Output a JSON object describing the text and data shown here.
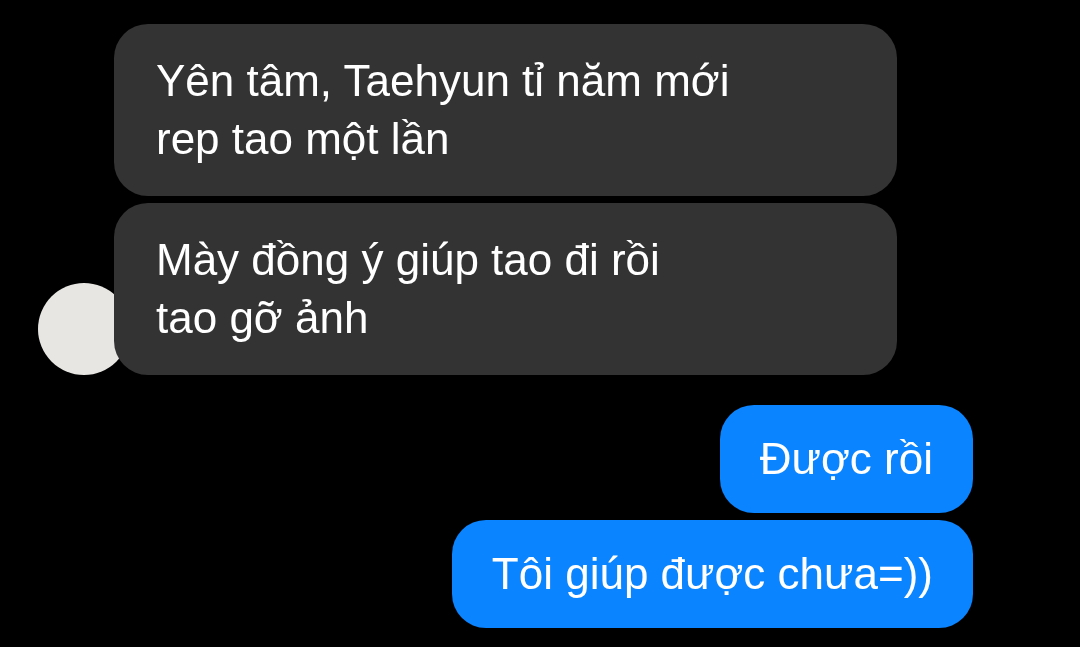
{
  "messages": [
    {
      "kind": "incoming",
      "text": "Yên tâm, Taehyun tỉ năm mới\nrep tao một lần",
      "avatar": false
    },
    {
      "kind": "incoming",
      "text": "Mày đồng ý giúp tao đi rồi\ntao gỡ ảnh",
      "avatar": true
    },
    {
      "kind": "outgoing",
      "text": "Được rồi"
    },
    {
      "kind": "outgoing",
      "text": "Tôi giúp được chưa=))"
    }
  ]
}
